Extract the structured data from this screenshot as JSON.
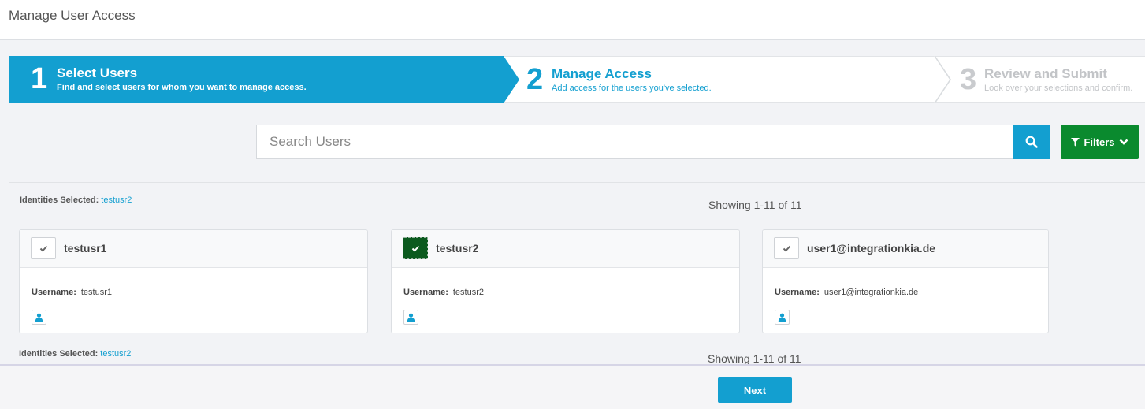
{
  "header": {
    "title": "Manage User Access"
  },
  "wizard": {
    "steps": [
      {
        "number": "1",
        "title": "Select Users",
        "description": "Find and select users for whom you want to manage access.",
        "state": "active"
      },
      {
        "number": "2",
        "title": "Manage Access",
        "description": "Add access for the users you've selected.",
        "state": "next"
      },
      {
        "number": "3",
        "title": "Review and Submit",
        "description": "Look over your selections and confirm.",
        "state": "disabled"
      }
    ]
  },
  "search": {
    "placeholder": "Search Users",
    "value": ""
  },
  "filters": {
    "label": "Filters"
  },
  "selection": {
    "label": "Identities Selected:",
    "selected": "testusr2"
  },
  "pagination": {
    "showing": "Showing 1-11 of 11"
  },
  "users": [
    {
      "name": "testusr1",
      "username_label": "Username:",
      "username": "testusr1",
      "checked": false
    },
    {
      "name": "testusr2",
      "username_label": "Username:",
      "username": "testusr2",
      "checked": true
    },
    {
      "name": "user1@integrationkia.de",
      "username_label": "Username:",
      "username": "user1@integrationkia.de",
      "checked": false
    }
  ],
  "footer": {
    "next_label": "Next"
  },
  "colors": {
    "primary": "#139fd0",
    "filters": "#0a8a2e",
    "checked": "#0b5a1e"
  },
  "icons": {
    "search": "search-icon",
    "filter": "funnel-icon",
    "chevron": "chevron-down-icon",
    "check": "check-icon",
    "user": "user-icon"
  }
}
